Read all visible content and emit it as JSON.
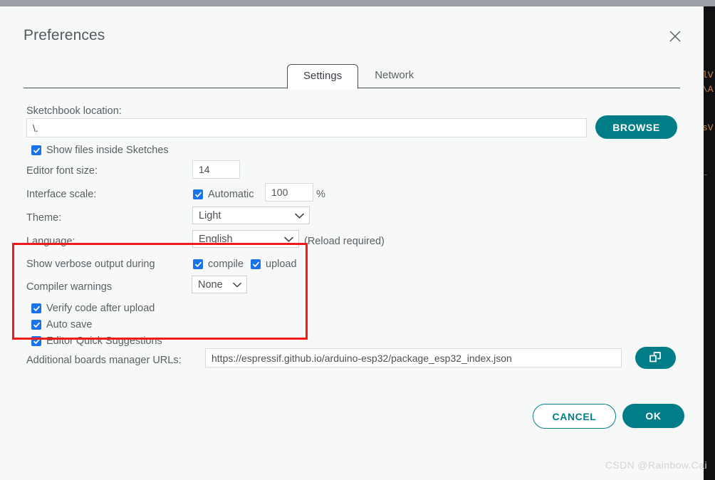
{
  "window": {
    "title": "Preferences",
    "close_icon": "close-icon",
    "background_app_hint": "code-editor"
  },
  "tabs": [
    {
      "label": "Settings",
      "active": true
    },
    {
      "label": "Network",
      "active": false
    }
  ],
  "settings": {
    "sketchbook": {
      "label": "Sketchbook location:",
      "value": "\\.",
      "placeholder": "",
      "browse_label": "BROWSE"
    },
    "show_files_inside_sketches": {
      "label": "Show files inside Sketches",
      "checked": true
    },
    "editor_font_size": {
      "label": "Editor font size:",
      "value": "14"
    },
    "interface_scale": {
      "label": "Interface scale:",
      "automatic_label": "Automatic",
      "automatic_checked": true,
      "value": "100",
      "unit": "%"
    },
    "theme": {
      "label": "Theme:",
      "value": "Light"
    },
    "language": {
      "label": "Language:",
      "value": "English",
      "note": "(Reload required)"
    },
    "verbose_output": {
      "label": "Show verbose output during",
      "compile_label": "compile",
      "compile_checked": true,
      "upload_label": "upload",
      "upload_checked": true
    },
    "compiler_warnings": {
      "label": "Compiler warnings",
      "value": "None"
    },
    "verify_code_after_upload": {
      "label": "Verify code after upload",
      "checked": true
    },
    "auto_save": {
      "label": "Auto save",
      "checked": true
    },
    "editor_quick_suggestions": {
      "label": "Editor Quick Suggestions",
      "checked": true
    },
    "additional_boards": {
      "label": "Additional boards manager URLs:",
      "value": "https://espressif.github.io/arduino-esp32/package_esp32_index.json",
      "button_icon": "open-window-icon"
    }
  },
  "footer": {
    "cancel_label": "CANCEL",
    "ok_label": "OK"
  },
  "annotation": {
    "highlight_color": "#f01a1a"
  },
  "watermark": "CSDN @Rainbow.Cai",
  "colors": {
    "accent_teal": "#007d86",
    "checkbox_blue": "#1a73e8",
    "dialog_bg": "#f7f8f8",
    "text": "#5b5f64"
  }
}
